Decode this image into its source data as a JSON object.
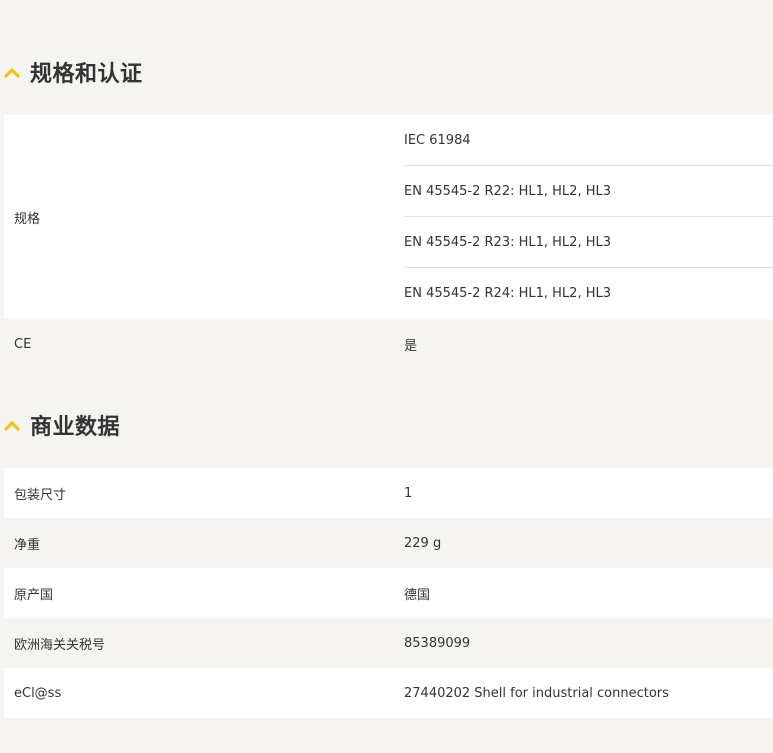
{
  "sections": [
    {
      "title": "规格和认证",
      "chevron_icon": "chevron-up-icon",
      "accent_color": "#f0c419",
      "rows": [
        {
          "label": "规格",
          "values": [
            "IEC 61984",
            "EN 45545-2 R22: HL1, HL2, HL3",
            "EN 45545-2 R23: HL1, HL2, HL3",
            "EN 45545-2 R24: HL1, HL2, HL3"
          ]
        },
        {
          "label": "CE",
          "value": "是"
        }
      ]
    },
    {
      "title": "商业数据",
      "chevron_icon": "chevron-up-icon",
      "accent_color": "#f0c419",
      "rows": [
        {
          "label": "包装尺寸",
          "value": "1"
        },
        {
          "label": "净重",
          "value": "229 g"
        },
        {
          "label": "原产国",
          "value": "德国"
        },
        {
          "label": "欧洲海关关税号",
          "value": "85389099"
        },
        {
          "label": "eCl@ss",
          "value": "27440202 Shell for industrial connectors"
        }
      ]
    }
  ]
}
